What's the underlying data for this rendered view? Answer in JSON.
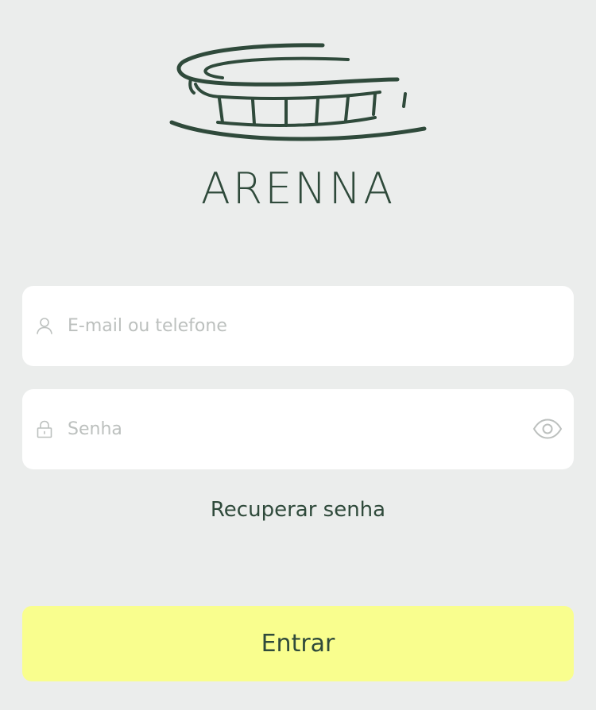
{
  "brand": {
    "logo_icon": "stadium-icon",
    "name": "ARENNA"
  },
  "login_form": {
    "email": {
      "icon": "user-icon",
      "value": "",
      "placeholder": "E-mail ou telefone"
    },
    "password": {
      "icon": "lock-icon",
      "value": "",
      "placeholder": "Senha",
      "toggle_icon": "eye-icon"
    },
    "recover_label": "Recuperar senha",
    "submit_label": "Entrar"
  },
  "colors": {
    "background": "#EBEDEC",
    "primary_text": "#2F4A3B",
    "field_background": "#FFFFFF",
    "placeholder": "#BCC0BE",
    "button_accent": "#F9FE8E"
  }
}
